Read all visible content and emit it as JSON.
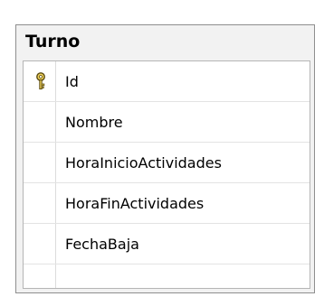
{
  "table": {
    "name": "Turno",
    "columns": [
      {
        "name": "Id",
        "primary_key": true
      },
      {
        "name": "Nombre",
        "primary_key": false
      },
      {
        "name": "HoraInicioActividades",
        "primary_key": false
      },
      {
        "name": "HoraFinActividades",
        "primary_key": false
      },
      {
        "name": "FechaBaja",
        "primary_key": false
      }
    ]
  },
  "icons": {
    "primary_key": "key-icon"
  },
  "colors": {
    "box_background": "#f2f2f2",
    "box_border": "#8e8e8e",
    "key_fill": "#f0d25a",
    "key_stroke": "#5a4a10"
  }
}
